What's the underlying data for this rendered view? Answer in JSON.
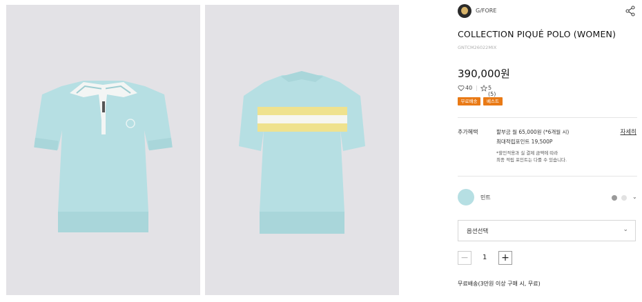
{
  "brand": {
    "name": "G/FORE",
    "logo_icon": "brand-avatar-icon"
  },
  "product": {
    "title": "COLLECTION PIQUÉ POLO (WOMEN)",
    "code": "GNTCM26022MIX",
    "price": "390,000원",
    "likes": "40",
    "divider": "|",
    "rating": "5 (5) ›",
    "badges": [
      "무료배송",
      "베스트"
    ]
  },
  "benefits": {
    "label": "추가혜택",
    "installment": "할부금 월 65,000원 (*6개월 시)",
    "points": "최대적립포인트 19,500P",
    "note1": "*할인적용과 실 결제 금액에 따라",
    "note2": "최종 적립 포인트는 다를 수 있습니다.",
    "detail_link": "자세히"
  },
  "color": {
    "name": "민트",
    "swatch_hex": "#b6dfe3",
    "chevron": "⌄",
    "options": [
      {
        "hex": "#9a9a9a",
        "label": "dark-gray"
      },
      {
        "hex": "#e2e2e2",
        "label": "light-gray"
      }
    ]
  },
  "option_select": {
    "placeholder": "옵션선택",
    "chevron": "⌄"
  },
  "quantity": {
    "minus": "−",
    "value": "1",
    "plus": "+"
  },
  "shipping": "무료배송(3만원 이상 구매 시, 무료)",
  "colors": {
    "badge": "#e97a16",
    "shirt": "#b6dfe3",
    "image_bg": "#e3e2e6",
    "stripe_yellow": "#efe28e"
  }
}
